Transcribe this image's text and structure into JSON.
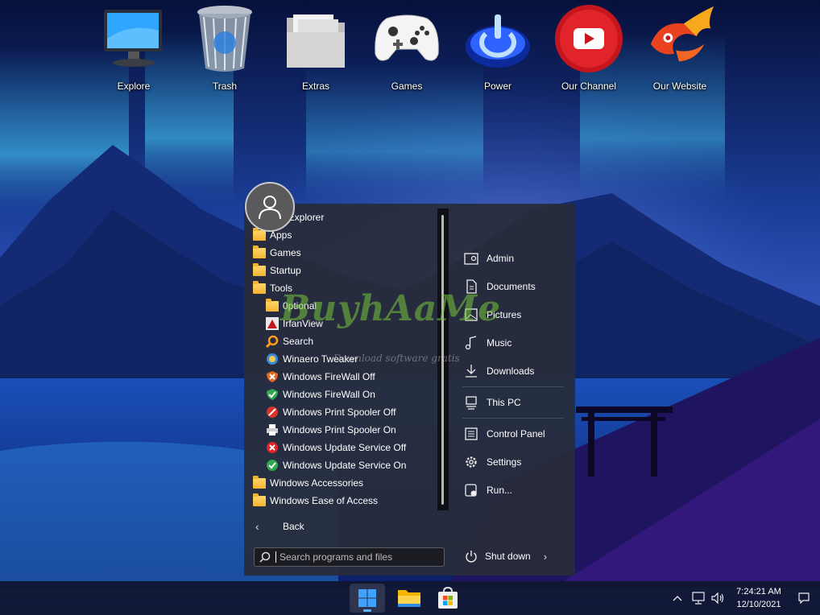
{
  "desktop": {
    "icons": [
      {
        "label": "Explore",
        "icon": "monitor-icon"
      },
      {
        "label": "Trash",
        "icon": "trash-icon"
      },
      {
        "label": "Extras",
        "icon": "folder-stack-icon"
      },
      {
        "label": "Games",
        "icon": "gamepad-icon"
      },
      {
        "label": "Power",
        "icon": "power-icon"
      },
      {
        "label": "Our Channel",
        "icon": "youtube-icon"
      },
      {
        "label": "Our Website",
        "icon": "phoenix-icon"
      }
    ]
  },
  "start_menu": {
    "programs": [
      {
        "label": "File Explorer",
        "icon": "file-explorer-icon",
        "indent": false
      },
      {
        "label": "Apps",
        "icon": "folder-icon",
        "indent": false
      },
      {
        "label": "Games",
        "icon": "folder-icon",
        "indent": false
      },
      {
        "label": "Startup",
        "icon": "folder-icon",
        "indent": false
      },
      {
        "label": "Tools",
        "icon": "folder-icon",
        "indent": false
      },
      {
        "label": "0ptional",
        "icon": "folder-icon",
        "indent": true
      },
      {
        "label": "IrfanView",
        "icon": "irfanview-icon",
        "indent": true
      },
      {
        "label": "Search",
        "icon": "search-icon",
        "indent": true
      },
      {
        "label": "Winaero Tweaker",
        "icon": "winaero-icon",
        "indent": true
      },
      {
        "label": "Windows FireWall Off",
        "icon": "firewall-off-icon",
        "indent": true
      },
      {
        "label": "Windows FireWall On",
        "icon": "firewall-on-icon",
        "indent": true
      },
      {
        "label": "Windows Print Spooler Off",
        "icon": "printer-off-icon",
        "indent": true
      },
      {
        "label": "Windows Print Spooler On",
        "icon": "printer-on-icon",
        "indent": true
      },
      {
        "label": "Windows Update Service Off",
        "icon": "update-off-icon",
        "indent": true
      },
      {
        "label": "Windows Update Service On",
        "icon": "update-on-icon",
        "indent": true
      },
      {
        "label": "Windows Accessories",
        "icon": "folder-icon",
        "indent": false
      },
      {
        "label": "Windows Ease of Access",
        "icon": "folder-icon",
        "indent": false
      }
    ],
    "back_label": "Back",
    "search_placeholder": "Search programs and files",
    "places": [
      {
        "label": "Admin",
        "icon": "user-folder-icon"
      },
      {
        "label": "Documents",
        "icon": "document-icon"
      },
      {
        "label": "Pictures",
        "icon": "picture-icon"
      },
      {
        "label": "Music",
        "icon": "music-icon"
      },
      {
        "label": "Downloads",
        "icon": "download-icon"
      },
      {
        "label": "This PC",
        "icon": "computer-icon"
      },
      {
        "label": "Control Panel",
        "icon": "control-panel-icon"
      },
      {
        "label": "Settings",
        "icon": "gear-icon"
      },
      {
        "label": "Run...",
        "icon": "run-icon"
      }
    ],
    "shutdown_label": "Shut down"
  },
  "watermark": {
    "title": "BuyhAaMe",
    "subtitle": "Download software gratis"
  },
  "taskbar": {
    "apps": [
      {
        "name": "start-button",
        "icon": "windows-logo-icon",
        "active": true
      },
      {
        "name": "file-explorer-taskbar",
        "icon": "folder-icon",
        "active": false
      },
      {
        "name": "store-taskbar",
        "icon": "store-icon",
        "active": false
      }
    ],
    "time": "7:24:21 AM",
    "date": "12/10/2021"
  },
  "colors": {
    "accent": "#5fb2ff",
    "menu_bg": "#282c3a"
  }
}
